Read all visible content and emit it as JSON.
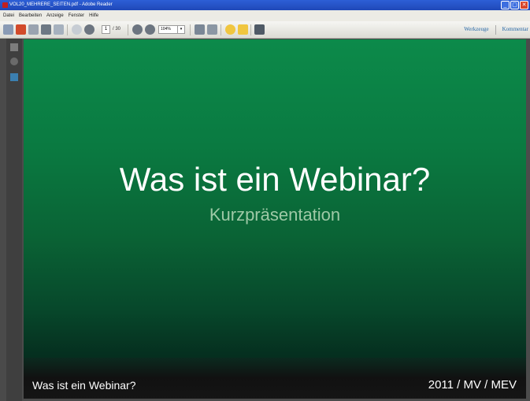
{
  "window": {
    "title": "VOL20_MEHRERE_SEITEN.pdf - Adobe Reader"
  },
  "menu": [
    "Datei",
    "Bearbeiten",
    "Anzeige",
    "Fenster",
    "Hilfe"
  ],
  "toolbar": {
    "page_current": "1",
    "page_total": "/ 30",
    "zoom": "104%",
    "tools_label": "Werkzeuge",
    "comment_label": "Kommentar"
  },
  "slide": {
    "title": "Was ist ein Webinar?",
    "subtitle": "Kurzpräsentation",
    "footer_left": "Was ist ein Webinar?",
    "footer_right": "2011 / MV / MEV"
  },
  "colors": {
    "titlebar": "#1f48b8",
    "link": "#2a6aa8",
    "slide_top": "#0c8a4a",
    "slide_bottom": "#042a1b"
  }
}
